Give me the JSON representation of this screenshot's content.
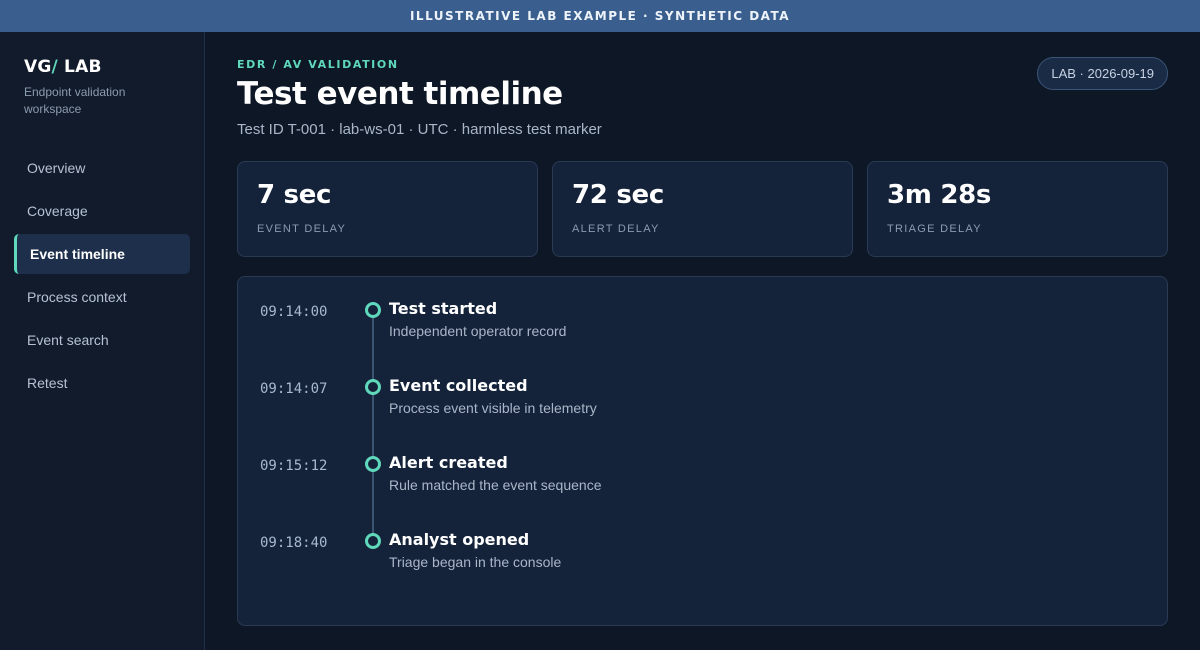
{
  "banner": {
    "text": "ILLUSTRATIVE LAB EXAMPLE · SYNTHETIC DATA"
  },
  "sidebar": {
    "brand_prefix": "VG",
    "brand_slash": "/",
    "brand_suffix": " LAB",
    "brand_sub": "Endpoint validation workspace",
    "items": [
      {
        "label": "Overview",
        "active": false
      },
      {
        "label": "Coverage",
        "active": false
      },
      {
        "label": "Event timeline",
        "active": true
      },
      {
        "label": "Process context",
        "active": false
      },
      {
        "label": "Event search",
        "active": false
      },
      {
        "label": "Retest",
        "active": false
      }
    ]
  },
  "header": {
    "eyebrow": "EDR / AV VALIDATION",
    "title": "Test event timeline",
    "subtitle": "Test ID T-001 · lab-ws-01 · UTC · harmless test marker",
    "badge": "LAB · 2026-09-19"
  },
  "stats": [
    {
      "value": "7 sec",
      "label": "EVENT DELAY"
    },
    {
      "value": "72 sec",
      "label": "ALERT DELAY"
    },
    {
      "value": "3m 28s",
      "label": "TRIAGE DELAY"
    }
  ],
  "timeline": {
    "events": [
      {
        "time": "09:14:00",
        "title": "Test started",
        "desc": "Independent operator record"
      },
      {
        "time": "09:14:07",
        "title": "Event collected",
        "desc": "Process event visible in telemetry"
      },
      {
        "time": "09:15:12",
        "title": "Alert created",
        "desc": "Rule matched the event sequence"
      },
      {
        "time": "09:18:40",
        "title": "Analyst opened",
        "desc": "Triage began in the console"
      }
    ]
  },
  "colors": {
    "accent": "#5fd8bb",
    "background": "#0d1726",
    "banner": "#3a5f8e"
  }
}
